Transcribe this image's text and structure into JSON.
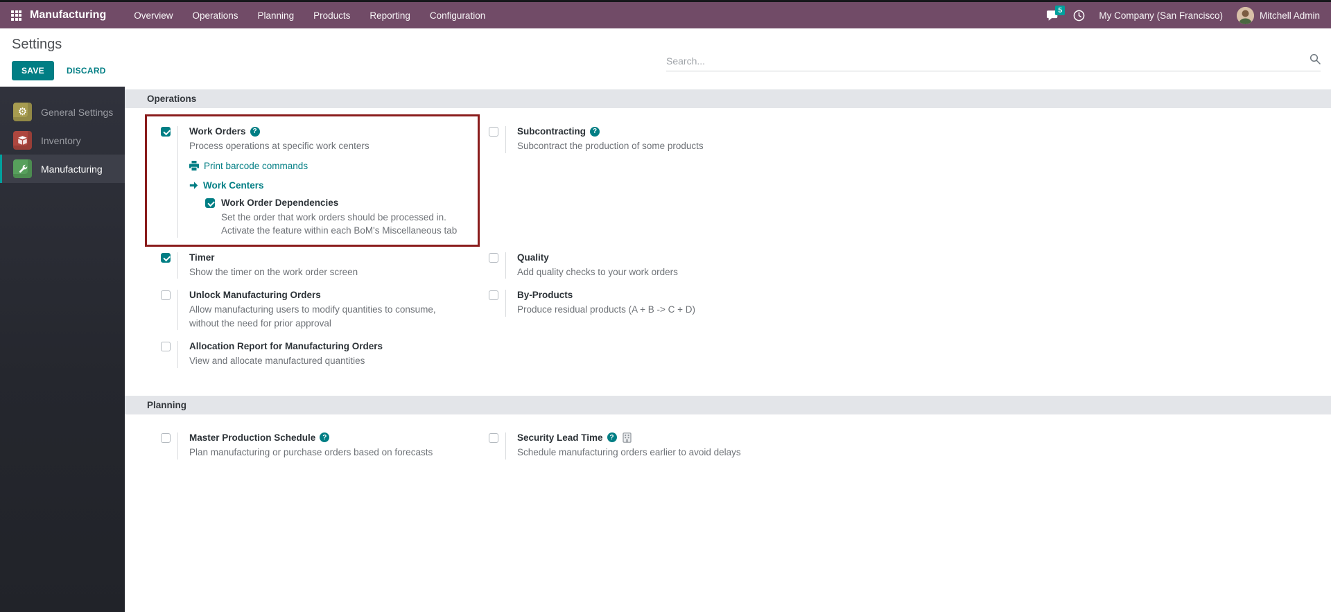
{
  "topbar": {
    "brand": "Manufacturing",
    "menus": [
      {
        "label": "Overview"
      },
      {
        "label": "Operations"
      },
      {
        "label": "Planning"
      },
      {
        "label": "Products"
      },
      {
        "label": "Reporting"
      },
      {
        "label": "Configuration"
      }
    ],
    "message_badge": "5",
    "company": "My Company (San Francisco)",
    "user": "Mitchell Admin"
  },
  "control_panel": {
    "title": "Settings",
    "save": "SAVE",
    "discard": "DISCARD",
    "search_placeholder": "Search..."
  },
  "sidebar": {
    "items": [
      {
        "label": "General Settings",
        "active": false
      },
      {
        "label": "Inventory",
        "active": false
      },
      {
        "label": "Manufacturing",
        "active": true
      }
    ]
  },
  "colors": {
    "topbar_purple": "#714b67",
    "accent_teal": "#017e84",
    "badge_teal": "#00a09d",
    "highlight_red": "#8a1c1c"
  },
  "sections": [
    {
      "title": "Operations",
      "settings": {
        "work_orders": {
          "label": "Work Orders",
          "checked": true,
          "highlighted": true,
          "desc": "Process operations at specific work centers",
          "link_print": "Print barcode commands",
          "link_work_centers": "Work Centers",
          "child": {
            "label": "Work Order Dependencies",
            "checked": true,
            "desc_lines": [
              "Set the order that work orders should be processed in.",
              "Activate the feature within each BoM's Miscellaneous tab"
            ]
          }
        },
        "subcontracting": {
          "label": "Subcontracting",
          "checked": false,
          "desc": "Subcontract the production of some products"
        },
        "timer": {
          "label": "Timer",
          "checked": true,
          "desc": "Show the timer on the work order screen"
        },
        "quality": {
          "label": "Quality",
          "checked": false,
          "desc": "Add quality checks to your work orders"
        },
        "unlock_mo": {
          "label": "Unlock Manufacturing Orders",
          "checked": false,
          "desc_lines": [
            "Allow manufacturing users to modify quantities to consume,",
            "without the need for prior approval"
          ]
        },
        "by_products": {
          "label": "By-Products",
          "checked": false,
          "desc": "Produce residual products (A + B -> C + D)"
        },
        "allocation_report": {
          "label": "Allocation Report for Manufacturing Orders",
          "checked": false,
          "desc": "View and allocate manufactured quantities"
        }
      }
    },
    {
      "title": "Planning",
      "settings": {
        "mps": {
          "label": "Master Production Schedule",
          "checked": false,
          "desc": "Plan manufacturing or purchase orders based on forecasts"
        },
        "security_lead_time": {
          "label": "Security Lead Time",
          "checked": false,
          "enterprise_feature": true,
          "desc": "Schedule manufacturing orders earlier to avoid delays"
        }
      }
    }
  ]
}
